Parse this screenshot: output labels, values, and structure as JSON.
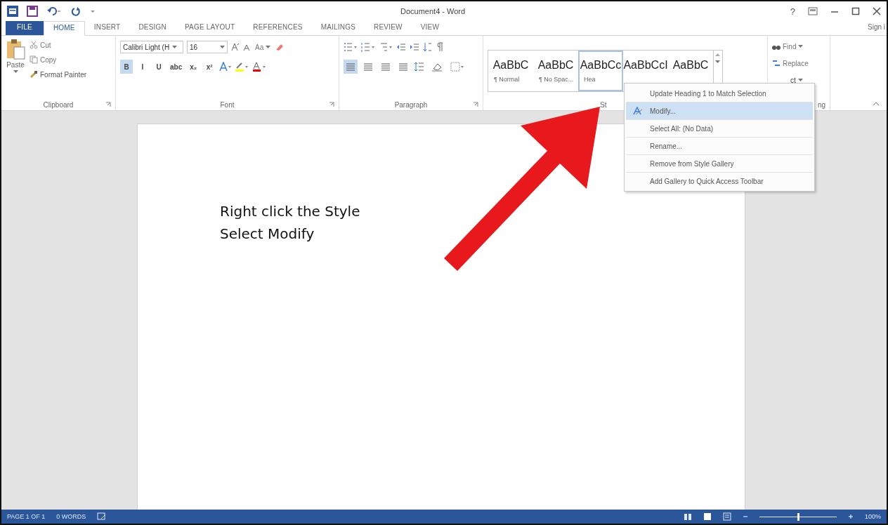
{
  "title_bar": {
    "title": "Document4 - Word",
    "help": "?"
  },
  "tabs": [
    {
      "label": "FILE",
      "kind": "file",
      "selected": false
    },
    {
      "label": "HOME",
      "kind": "tab",
      "selected": true
    },
    {
      "label": "INSERT",
      "kind": "tab",
      "selected": false
    },
    {
      "label": "DESIGN",
      "kind": "tab",
      "selected": false
    },
    {
      "label": "PAGE LAYOUT",
      "kind": "tab",
      "selected": false
    },
    {
      "label": "REFERENCES",
      "kind": "tab",
      "selected": false
    },
    {
      "label": "MAILINGS",
      "kind": "tab",
      "selected": false
    },
    {
      "label": "REVIEW",
      "kind": "tab",
      "selected": false
    },
    {
      "label": "VIEW",
      "kind": "tab",
      "selected": false
    }
  ],
  "sign_in": "Sign i",
  "clipboard": {
    "label": "Clipboard",
    "paste": "Paste",
    "cut": "Cut",
    "copy": "Copy",
    "format_painter": "Format Painter"
  },
  "font": {
    "label": "Font",
    "font_name": "Calibri Light (H",
    "font_size": "16",
    "change_case": "Aa",
    "format_buttons": [
      {
        "label": "B",
        "selected": true
      },
      {
        "label": "I",
        "selected": false
      },
      {
        "label": "U",
        "selected": false
      },
      {
        "label": "abc",
        "selected": false
      },
      {
        "label": "x₂",
        "selected": false
      },
      {
        "label": "x²",
        "selected": false
      }
    ]
  },
  "paragraph": {
    "label": "Paragraph",
    "alignments": [
      {
        "selected": true
      },
      {
        "selected": false
      },
      {
        "selected": false
      },
      {
        "selected": false
      }
    ]
  },
  "styles": {
    "label": "St",
    "items": [
      {
        "preview": "AaBbC",
        "name": "¶ Normal",
        "selected": false
      },
      {
        "preview": "AaBbC",
        "name": "¶ No Spac...",
        "selected": false
      },
      {
        "preview": "AaBbCc",
        "name": "Hea",
        "selected": true
      },
      {
        "preview": "AaBbCcI",
        "selected": false
      },
      {
        "preview": "AaBbC",
        "selected": false
      }
    ]
  },
  "editing": {
    "label": "ng",
    "find": "Find",
    "replace": "Replace",
    "select": "ct"
  },
  "document": {
    "lines": [
      "Right click the Style",
      "Select Modify"
    ]
  },
  "context_menu": [
    {
      "label": "Update Heading 1 to Match Selection",
      "selected": false
    },
    {
      "label": "Modify...",
      "selected": true
    },
    {
      "label": "Select All: (No Data)",
      "selected": false
    },
    {
      "label": "Rename...",
      "selected": false
    },
    {
      "label": "Remove from Style Gallery",
      "selected": false
    },
    {
      "label": "Add Gallery to Quick Access Toolbar",
      "selected": false
    }
  ],
  "status_bar": {
    "page": "PAGE 1 OF 1",
    "words": "0 WORDS",
    "zoom": "100%",
    "zoom_level": {
      "level": 0.5
    }
  }
}
